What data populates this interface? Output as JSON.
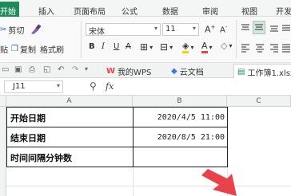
{
  "ribbon_tabs": [
    "开始",
    "插入",
    "页面布局",
    "公式",
    "数据",
    "审阅",
    "视图",
    "开发"
  ],
  "toolbar": {
    "cut_label": "剪切",
    "paste_label": "贴",
    "copy_label": "复制",
    "format_painter_label": "格式刷",
    "font_name": "宋体",
    "font_size": "11",
    "bold": "B",
    "italic": "I",
    "underline": "U"
  },
  "doc_tabs": {
    "wps": "我的WPS",
    "cloud": "云文档",
    "file": "工作簿1.xlsx"
  },
  "formula_bar": {
    "name_box": "J11",
    "fx": "fx"
  },
  "sheet": {
    "col_a": "A",
    "col_b": "B",
    "col_c": "C",
    "rows": [
      {
        "label": "开始日期",
        "value": "2020/4/5 11:00"
      },
      {
        "label": "结束日期",
        "value": "2020/8/5 21:00"
      },
      {
        "label": "时间间隔分钟数",
        "value": ""
      }
    ]
  },
  "colors": {
    "accent": "#1e8c5a",
    "arrow": "#e8424a"
  }
}
